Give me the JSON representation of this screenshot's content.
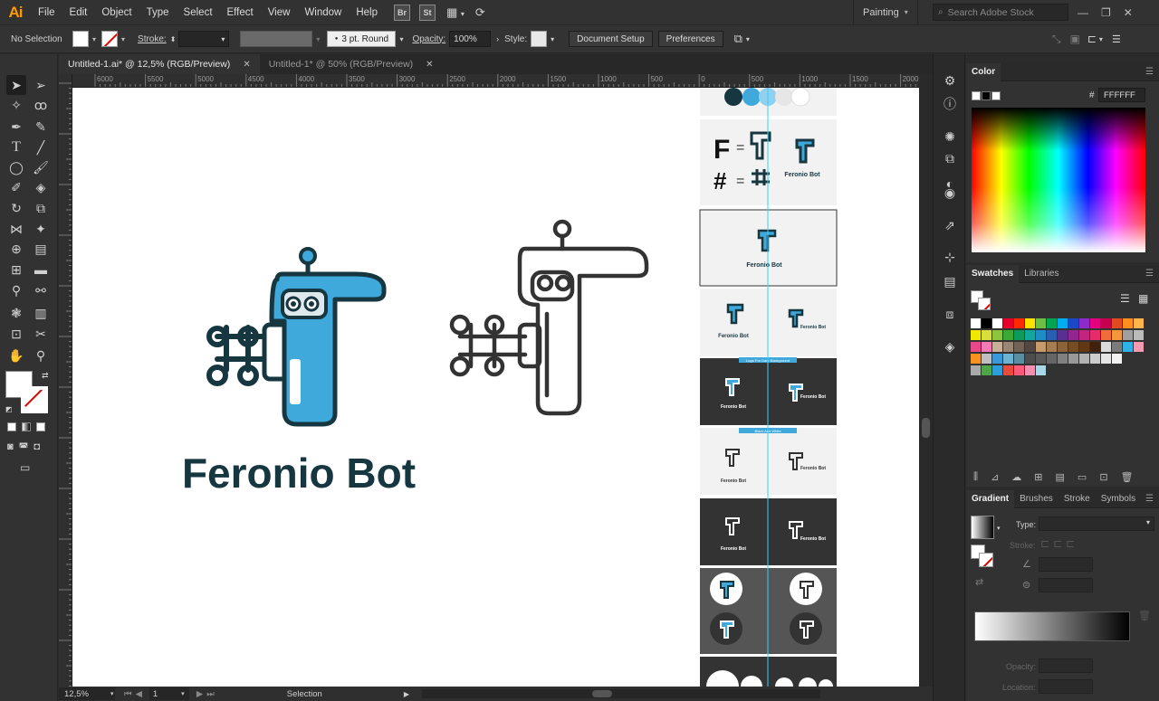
{
  "app": {
    "logo": "Ai"
  },
  "menu": [
    "File",
    "Edit",
    "Object",
    "Type",
    "Select",
    "Effect",
    "View",
    "Window",
    "Help"
  ],
  "menubar_icons": {
    "bridge": "Br",
    "stock": "St"
  },
  "workspace": {
    "label": "Painting"
  },
  "search": {
    "placeholder": "Search Adobe Stock"
  },
  "control": {
    "selection": "No Selection",
    "stroke_label": "Stroke:",
    "brush": "3 pt. Round",
    "opacity_label": "Opacity:",
    "opacity_value": "100%",
    "style_label": "Style:",
    "document_setup": "Document Setup",
    "preferences": "Preferences"
  },
  "tabs": [
    {
      "label": "Untitled-1.ai* @ 12,5% (RGB/Preview)",
      "active": true
    },
    {
      "label": "Untitled-1* @ 50% (RGB/Preview)",
      "active": false
    }
  ],
  "ruler_labels": [
    "6000",
    "5500",
    "5000",
    "4500",
    "4000",
    "3500",
    "3000",
    "2500",
    "2000",
    "1500",
    "1000",
    "500",
    "0",
    "500",
    "1000",
    "1500",
    "2000"
  ],
  "artwork": {
    "logo_title": "Feronio Bot",
    "legend_f": "F",
    "legend_hash": "#",
    "legend_equals": "=",
    "mini_title": "Feronio Bot",
    "banner_dark": "Logo For Dark Background",
    "banner_white": "Black And White"
  },
  "status": {
    "zoom": "12,5%",
    "artboard": "1",
    "tool": "Selection"
  },
  "color_panel": {
    "title": "Color",
    "hex": "FFFFFF"
  },
  "swatches_panel": {
    "title": "Swatches",
    "other_tab": "Libraries"
  },
  "gradient_panel": {
    "title": "Gradient",
    "tabs": [
      "Brushes",
      "Stroke",
      "Symbols"
    ],
    "type_label": "Type:",
    "stroke_label": "Stroke:",
    "opacity_label": "Opacity:",
    "location_label": "Location:"
  },
  "colors": {
    "accent_blue": "#3fa9dc",
    "dark_teal": "#163640",
    "ai_orange": "#ff9a00"
  }
}
